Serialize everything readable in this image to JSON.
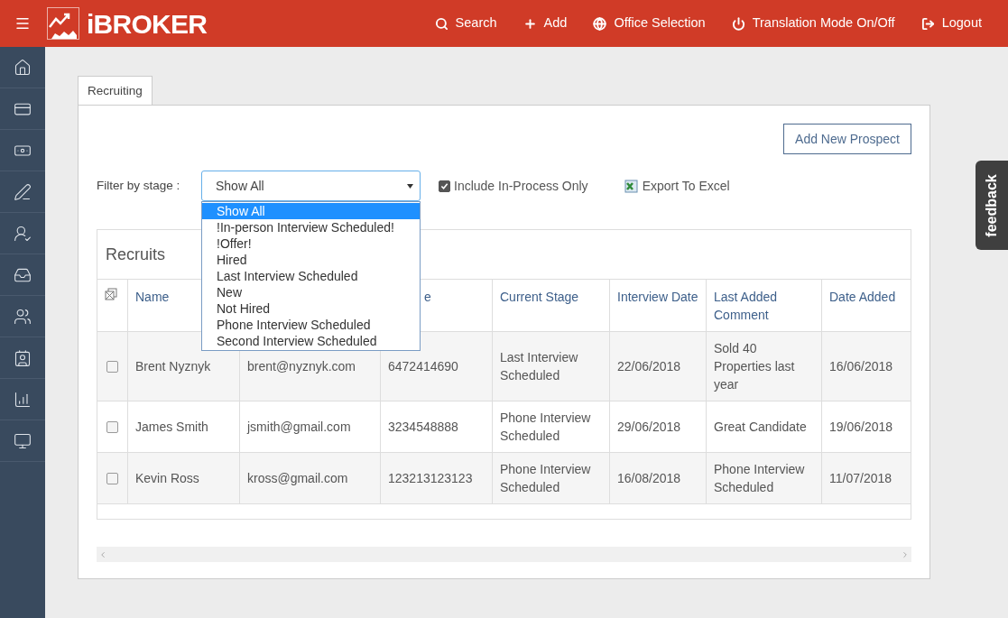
{
  "app": {
    "logo": "iBROKER"
  },
  "nav": [
    {
      "kind": "search",
      "label": "Search"
    },
    {
      "kind": "add",
      "label": "Add"
    },
    {
      "kind": "globe",
      "label": "Office Selection"
    },
    {
      "kind": "power",
      "label": "Translation Mode On/Off"
    },
    {
      "kind": "logout",
      "label": "Logout"
    }
  ],
  "sidebar": {
    "items": [
      {
        "kind": "house"
      },
      {
        "kind": "card-lock"
      },
      {
        "kind": "money"
      },
      {
        "kind": "check"
      },
      {
        "kind": "person-star"
      },
      {
        "kind": "inbox"
      },
      {
        "kind": "people"
      },
      {
        "kind": "contact"
      },
      {
        "kind": "chart"
      },
      {
        "kind": "monitor"
      }
    ]
  },
  "tabs": [
    {
      "label": "Recruiting",
      "selected": true
    }
  ],
  "add_button": "Add New Prospect",
  "filter": {
    "label": "Filter by stage :",
    "value": "Show All",
    "expanded": true,
    "options": [
      {
        "label": "Show All",
        "selected": true
      },
      {
        "label": "!In-person Interview Scheduled!",
        "selected": false
      },
      {
        "label": "!Offer!",
        "selected": false
      },
      {
        "label": "Hired",
        "selected": false
      },
      {
        "label": "Last Interview Scheduled",
        "selected": false
      },
      {
        "label": "New",
        "selected": false
      },
      {
        "label": "Not Hired",
        "selected": false
      },
      {
        "label": "Phone Interview Scheduled",
        "selected": false
      },
      {
        "label": "Second Interview Scheduled",
        "selected": false
      }
    ]
  },
  "include_in_process": {
    "label": "Include In-Process Only",
    "checked": true
  },
  "export": "Export To Excel",
  "feedback": "feedback",
  "table": {
    "title": "Recruits",
    "columns": [
      {
        "label": "Name"
      },
      {},
      {
        "label": "e"
      },
      {
        "label": "Current Stage"
      },
      {
        "label": "Interview Date"
      },
      {
        "label": "Last Added Comment"
      },
      {
        "label": "Date Added"
      }
    ],
    "rows": [
      {
        "checked": false,
        "cells": [
          "Brent Nyznyk",
          "brent@nyznyk.com",
          "6472414690",
          "Last Interview Scheduled",
          "22/06/2018",
          "Sold 40 Properties last year",
          "16/06/2018"
        ]
      },
      {
        "checked": false,
        "cells": [
          "James Smith",
          "jsmith@gmail.com",
          "3234548888",
          "Phone Interview Scheduled",
          "29/06/2018",
          "Great Candidate",
          "19/06/2018"
        ]
      },
      {
        "checked": false,
        "cells": [
          "Kevin Ross",
          "kross@gmail.com",
          "123213123123",
          "Phone Interview Scheduled",
          "16/08/2018",
          "Phone Interview Scheduled",
          "11/07/2018"
        ]
      }
    ]
  }
}
